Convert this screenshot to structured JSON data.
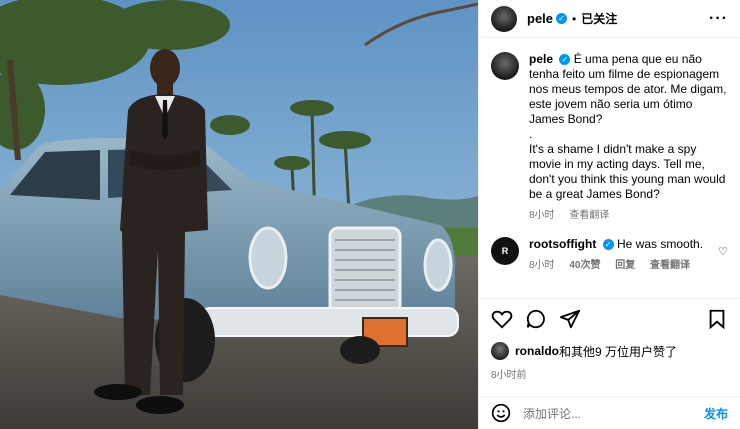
{
  "post": {
    "username": "pele",
    "separator": "•",
    "follow_label": "已关注",
    "more_icon": "more-icon"
  },
  "caption": {
    "username": "pele",
    "text": "É uma pena que eu não tenha feito um filme de espionagem nos meus tempos de ator. Me digam, este jovem não seria um ótimo James Bond?\n.\nIt's a shame I didn't make a spy movie in my acting days. Tell me, don't you think this young man would be a great James Bond?",
    "time": "8小时",
    "translate": "查看翻译"
  },
  "comment": {
    "username": "rootsoffight",
    "avatar_text": "R",
    "text": "He was smooth.",
    "time": "8小时",
    "likes": "40次赞",
    "reply": "回复",
    "translate": "查看翻译"
  },
  "likes": {
    "user": "ronaldo",
    "rest": "和其他9 万位用户赞了"
  },
  "timestamp": "8小时前",
  "add_comment": {
    "placeholder": "添加评论...",
    "post_label": "发布"
  },
  "colors": {
    "accent": "#0095f6",
    "muted": "#737373",
    "border": "#efefef"
  }
}
